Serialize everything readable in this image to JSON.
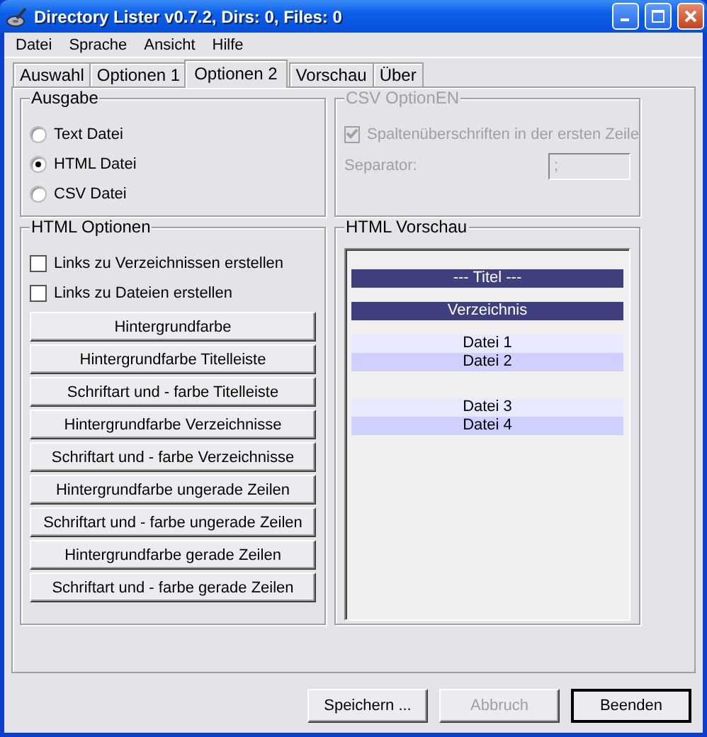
{
  "window": {
    "title": "Directory Lister v0.7.2, Dirs: 0, Files: 0"
  },
  "menu": [
    "Datei",
    "Sprache",
    "Ansicht",
    "Hilfe"
  ],
  "tabs": [
    {
      "label": "Auswahl",
      "selected": false
    },
    {
      "label": "Optionen 1",
      "selected": false
    },
    {
      "label": "Optionen 2",
      "selected": true
    },
    {
      "label": "Vorschau",
      "selected": false
    },
    {
      "label": "Über",
      "selected": false
    }
  ],
  "ausgabe": {
    "title": "Ausgabe",
    "options": [
      {
        "label": "Text Datei",
        "selected": false
      },
      {
        "label": "HTML Datei",
        "selected": true
      },
      {
        "label": "CSV Datei",
        "selected": false
      }
    ]
  },
  "csv": {
    "title": "CSV OptionEN",
    "disabled": true,
    "header_checkbox": {
      "label": "Spaltenüberschriften in der ersten Zeile",
      "checked": true
    },
    "separator": {
      "label": "Separator:",
      "value": ";"
    }
  },
  "html_options": {
    "title": "HTML Optionen",
    "checkboxes": [
      {
        "label": "Links zu Verzeichnissen erstellen",
        "checked": false
      },
      {
        "label": "Links zu Dateien erstellen",
        "checked": false
      }
    ],
    "buttons": [
      "Hintergrundfarbe",
      "Hintergrundfarbe Titelleiste",
      "Schriftart und - farbe Titelleiste",
      "Hintergrundfarbe Verzeichnisse",
      "Schriftart und - farbe Verzeichnisse",
      "Hintergrundfarbe ungerade Zeilen",
      "Schriftart und - farbe ungerade Zeilen",
      "Hintergrundfarbe gerade Zeilen",
      "Schriftart und - farbe gerade Zeilen"
    ]
  },
  "preview": {
    "title": "HTML Vorschau",
    "sections": [
      {
        "kind": "title",
        "text": "--- Titel ---"
      },
      {
        "kind": "directory",
        "text": "Verzeichnis"
      },
      {
        "kind": "files",
        "rows": [
          {
            "text": "Datei 1",
            "kind": "odd"
          },
          {
            "text": "Datei 2",
            "kind": "even"
          }
        ]
      },
      {
        "kind": "files",
        "rows": [
          {
            "text": "Datei 3",
            "kind": "odd"
          },
          {
            "text": "Datei 4",
            "kind": "even"
          }
        ]
      }
    ]
  },
  "buttons": [
    {
      "label": "Speichern ...",
      "disabled": false,
      "default": false
    },
    {
      "label": "Abbruch",
      "disabled": true,
      "default": false
    },
    {
      "label": "Beenden",
      "disabled": false,
      "default": true
    }
  ]
}
